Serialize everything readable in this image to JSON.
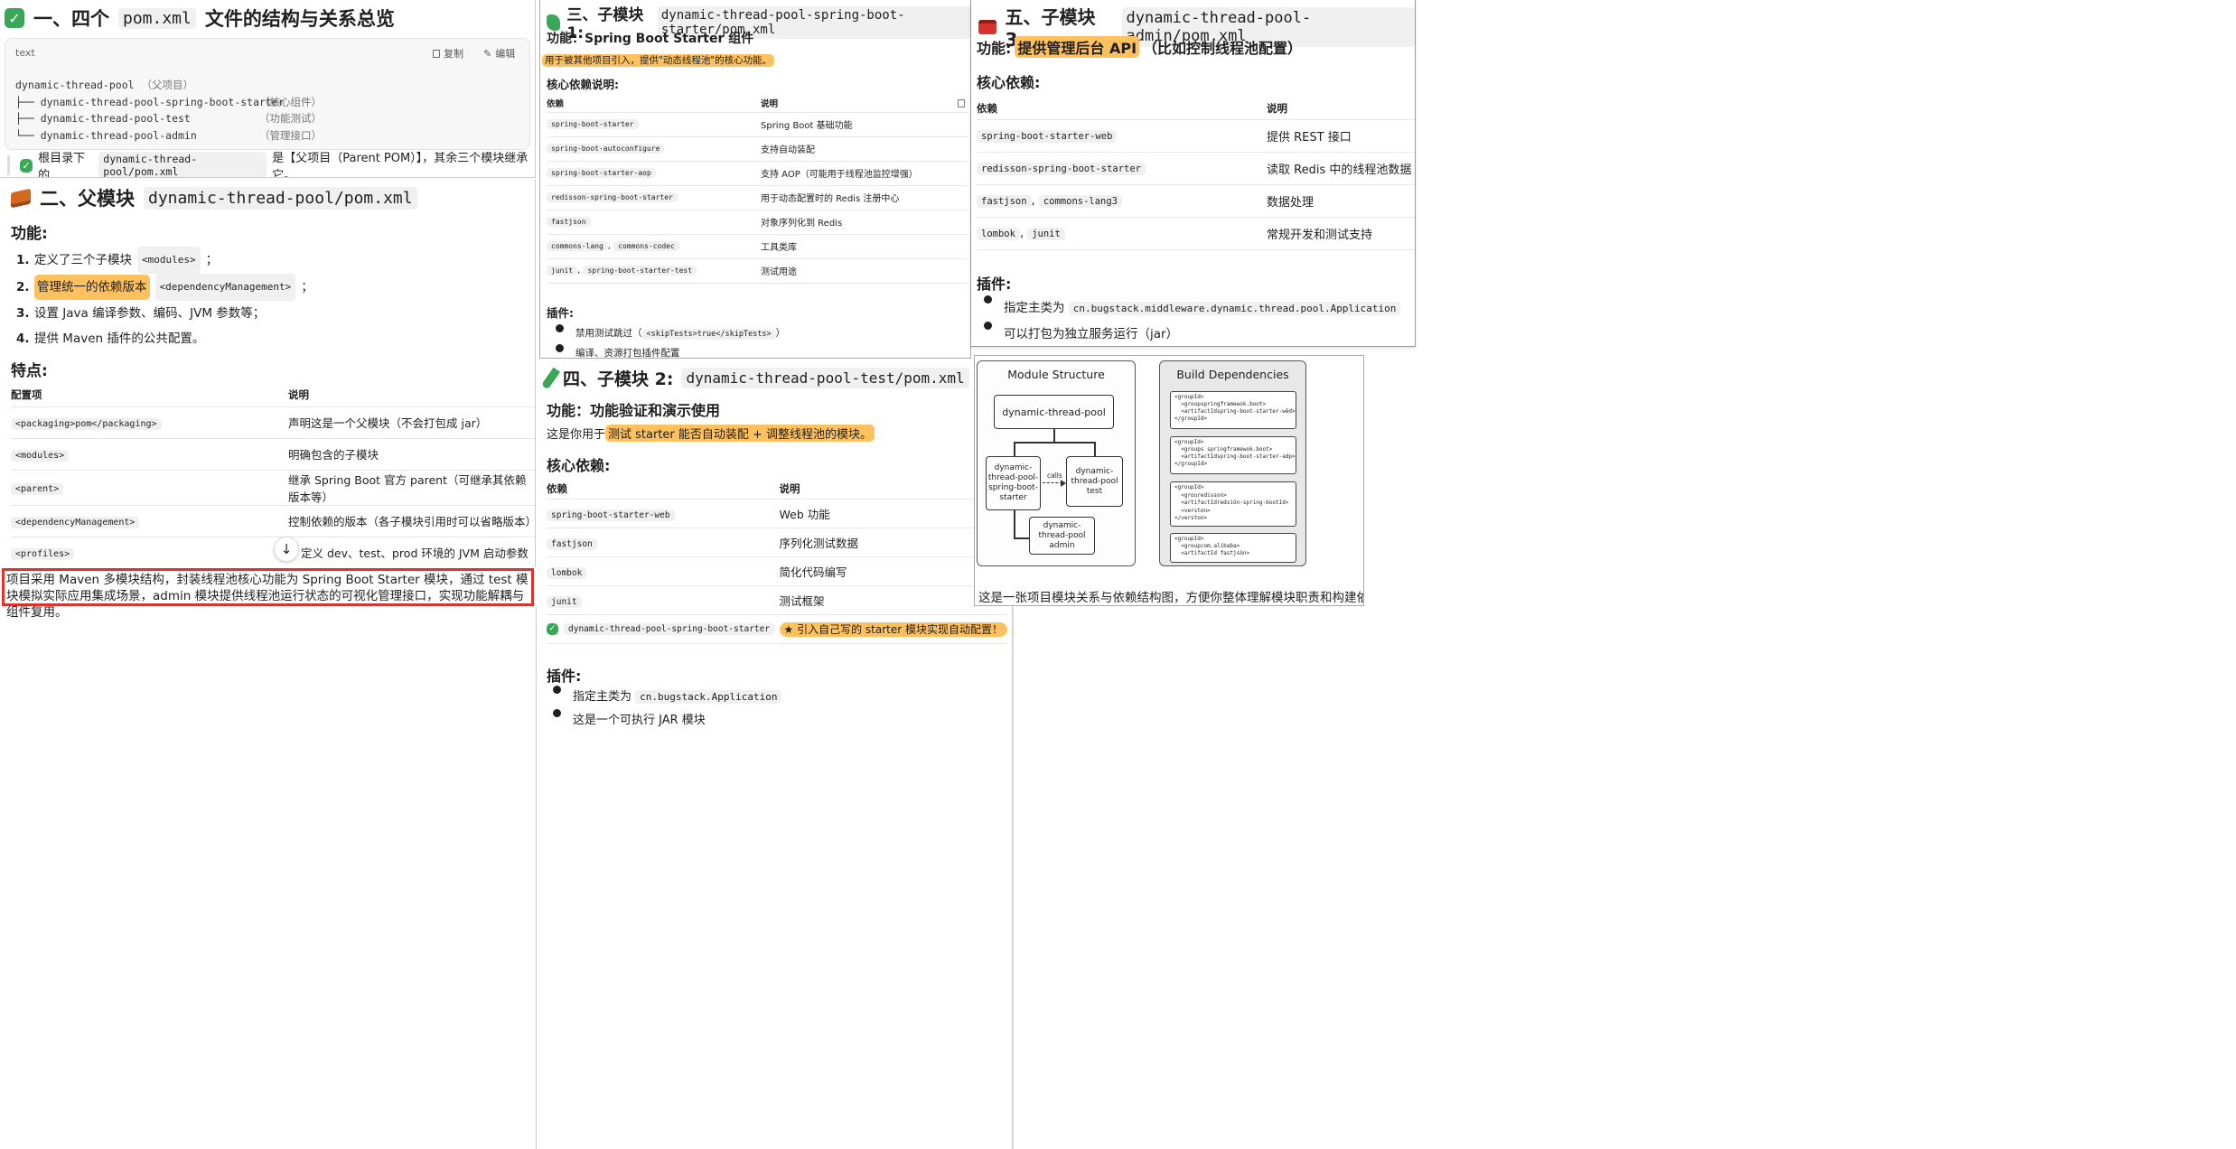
{
  "p1": {
    "title_prefix": "一、四个",
    "title_code": "pom.xml",
    "title_suffix": "文件的结构与关系总览",
    "code_lang": "text",
    "copy": "复制",
    "edit": "编辑",
    "tree": [
      [
        "dynamic-thread-pool",
        "（父项目）"
      ],
      [
        "├── dynamic-thread-pool-spring-boot-starter",
        "（核心组件）"
      ],
      [
        "├── dynamic-thread-pool-test",
        "（功能测试）"
      ],
      [
        "└── dynamic-thread-pool-admin",
        "（管理接口）"
      ]
    ],
    "note_prefix": "根目录下的",
    "note_code": "dynamic-thread-pool/pom.xml",
    "note_suffix": "是【父项目（Parent POM）】，其余三个模块继承它。"
  },
  "p2": {
    "title": "二、父模块",
    "title_code": "dynamic-thread-pool/pom.xml",
    "func_heading": "功能:",
    "items": [
      {
        "num": "1.",
        "pre": "定义了三个子模块",
        "code": "<modules>",
        "post": "；"
      },
      {
        "num": "2.",
        "hl": "管理统一的依赖版本",
        "code": "<dependencyManagement>",
        "post": "；"
      },
      {
        "num": "3.",
        "pre": "设置 Java 编译参数、编码、JVM 参数等；"
      },
      {
        "num": "4.",
        "pre": "提供 Maven 插件的公共配置。"
      }
    ],
    "features_heading": "特点:",
    "col1": "配置项",
    "col2": "说明",
    "rows": [
      [
        "<packaging>pom</packaging>",
        "声明这是一个父模块（不会打包成 jar）"
      ],
      [
        "<modules>",
        "明确包含的子模块"
      ],
      [
        "<parent>",
        "继承 Spring Boot 官方 parent（可继承其依赖版本等）"
      ],
      [
        "<dependencyManagement>",
        "控制依赖的版本（各子模块引用时可以省略版本）"
      ],
      [
        "<profiles>",
        "定义 dev、test、prod 环境的 JVM 启动参数"
      ]
    ],
    "scroll_arrow": "↓"
  },
  "summary": "项目采用 Maven 多模块结构，封装线程池核心功能为 Spring Boot Starter 模块，通过 test 模块模拟实际应用集成场景，admin 模块提供线程池运行状态的可视化管理接口，实现功能解耦与组件复用。",
  "p3": {
    "title": "三、子模块 1:",
    "title_code": "dynamic-thread-pool-spring-boot-starter/pom.xml",
    "func": "功能：Spring Boot Starter 组件",
    "hl": "用于被其他项目引入，提供\"动态线程池\"的核心功能。",
    "deps_heading": "核心依赖说明:",
    "col1": "依赖",
    "col2": "说明",
    "rows": [
      [
        [
          "spring-boot-starter"
        ],
        "Spring Boot 基础功能"
      ],
      [
        [
          "spring-boot-autoconfigure"
        ],
        "支持自动装配"
      ],
      [
        [
          "spring-boot-starter-aop"
        ],
        "支持 AOP（可能用于线程池监控增强）"
      ],
      [
        [
          "redisson-spring-boot-starter"
        ],
        "用于动态配置时的 Redis 注册中心"
      ],
      [
        [
          "fastjson"
        ],
        "对象序列化到 Redis"
      ],
      [
        [
          "commons-lang",
          "commons-codec"
        ],
        "工具类库"
      ],
      [
        [
          "junit",
          "spring-boot-starter-test"
        ],
        "测试用途"
      ]
    ],
    "plugins_heading": "插件:",
    "plugin1_pre": "禁用测试跳过（",
    "plugin1_code": "<skipTests>true</skipTests>",
    "plugin1_post": "）",
    "plugin2": "编译、资源打包插件配置"
  },
  "p4": {
    "title": "四、子模块 2:",
    "title_code": "dynamic-thread-pool-test/pom.xml",
    "func": "功能：功能验证和演示使用",
    "desc_pre": "这是你用于",
    "desc_hl": "测试 starter 能否自动装配 + 调整线程池的模块。",
    "deps_heading": "核心依赖:",
    "col1": "依赖",
    "col2": "说明",
    "rows": [
      [
        "spring-boot-starter-web",
        "Web 功能"
      ],
      [
        "fastjson",
        "序列化测试数据"
      ],
      [
        "lombok",
        "简化代码编写"
      ],
      [
        "junit",
        "测试框架"
      ]
    ],
    "special_row_code": "dynamic-thread-pool-spring-boot-starter",
    "special_row_desc": "★ 引入自己写的 starter 模块实现自动配置！",
    "plugins_heading": "插件:",
    "plugin1_pre": "指定主类为",
    "plugin1_code": "cn.bugstack.Application",
    "plugin2": "这是一个可执行 JAR 模块"
  },
  "p5": {
    "title": "五、子模块 3:",
    "title_code": "dynamic-thread-pool-admin/pom.xml",
    "func_pre": "功能:",
    "func_hl": "提供管理后台 API",
    "func_post": "（比如控制线程池配置）",
    "deps_heading": "核心依赖:",
    "col1": "依赖",
    "col2": "说明",
    "rows": [
      [
        [
          "spring-boot-starter-web"
        ],
        "提供 REST 接口"
      ],
      [
        [
          "redisson-spring-boot-starter"
        ],
        "读取 Redis 中的线程池数据"
      ],
      [
        [
          "fastjson",
          "commons-lang3"
        ],
        "数据处理"
      ],
      [
        [
          "lombok",
          "junit"
        ],
        "常规开发和测试支持"
      ]
    ],
    "plugins_heading": "插件:",
    "plugin1_pre": "指定主类为",
    "plugin1_code": "cn.bugstack.middleware.dynamic.thread.pool.Application",
    "plugin2": "可以打包为独立服务运行（jar）"
  },
  "diagram": {
    "left_title": "Module Structure",
    "right_title": "Build Dependencies",
    "root": "dynamic-thread-pool",
    "starter": "dynamic-\nthread-pool-\nspring-boot-\nstarter",
    "test": "dynamic-\nthread-pool\ntest",
    "admin": "dynamic-\nthread-pool\nadmin",
    "calls": "calls",
    "blocks": [
      [
        "<groupId>",
        "  <groupspringframewok.boot>",
        "  <artifactIdspring-boot-starter-wêd>",
        "</groupId>"
      ],
      [
        "<groupId>",
        "  <groups springframewok.boot>",
        "  <artifactIdspring-boot-starter-adp>",
        "</groupId>"
      ],
      [
        "<groupId>",
        "  <grouredisson>",
        "  <artifactIdredsiön-spring-bootId>",
        "  <verston>",
        "</verston>"
      ],
      [
        "<groupId>",
        "  <groupcom.alibaba>",
        "  <artifactId fastjsön>"
      ]
    ],
    "caption": "这是一张项目模块关系与依赖结构图，方便你整体理解模块职责和构建依赖。"
  }
}
